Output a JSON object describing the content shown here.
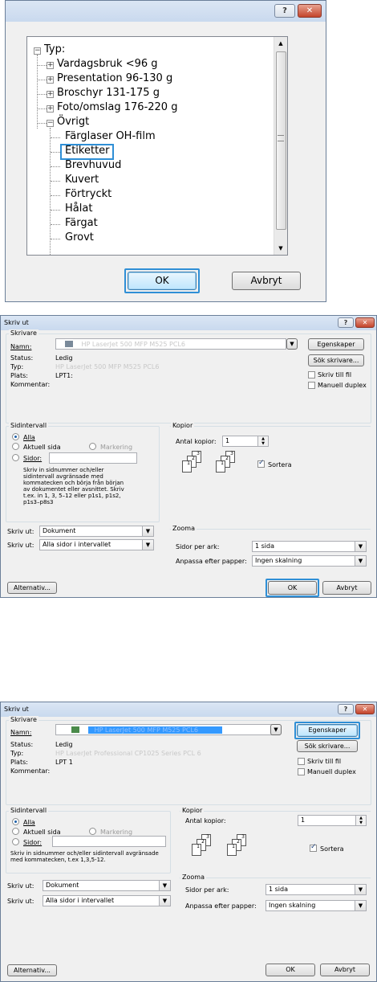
{
  "dialog1": {
    "help_label": "?",
    "close_label": "✕",
    "tree": {
      "root": "Typ:",
      "children": [
        "Vardagsbruk <96 g",
        "Presentation 96-130 g",
        "Broschyr 131-175 g",
        "Foto/omslag 176-220 g"
      ],
      "expanded": "Övrigt",
      "subitems": [
        "Färglaser OH-film",
        "Etiketter",
        "Brevhuvud",
        "Kuvert",
        "Förtryckt",
        "Hålat",
        "Färgat",
        "Grovt"
      ],
      "selected": "Etiketter"
    },
    "ok_label": "OK",
    "cancel_label": "Avbryt"
  },
  "dialog2": {
    "title": "Skriv ut",
    "printer_group": "Skrivare",
    "name_label": "Namn:",
    "printer_name": "HP LaserJet 500 MFP M525 PCL6",
    "properties_label": "Egenskaper",
    "find_printer_label": "Sök skrivare...",
    "status_label": "Status:",
    "status_value": "Ledig",
    "type_label": "Typ:",
    "type_value": "HP LaserJet 500 MFP M525 PCL6",
    "location_label": "Plats:",
    "location_value": "LPT1:",
    "comment_label": "Kommentar:",
    "print_to_file": "Skriv till fil",
    "manual_duplex": "Manuell duplex",
    "range_group": "Sidintervall",
    "all": "Alla",
    "current_page": "Aktuell sida",
    "selection": "Markering",
    "pages": "Sidor:",
    "help_text": "Skriv in sidnummer och/eller sidintervall avgränsade med kommatecken och börja från början av dokumentet eller avsnittet. Skriv t.ex. in 1, 3, 5–12 eller p1s1, p1s2, p1s3–p8s3",
    "print_what_label": "Skriv ut:",
    "print_what_value": "Dokument",
    "print_label": "Skriv ut:",
    "print_value": "Alla sidor i intervallet",
    "copies_group": "Kopior",
    "copies_label": "Antal kopior:",
    "copies_value": "1",
    "collate": "Sortera",
    "zoom_group": "Zooma",
    "pages_per_sheet_label": "Sidor per ark:",
    "pages_per_sheet_value": "1 sida",
    "scale_label": "Anpassa efter papper:",
    "scale_value": "Ingen skalning",
    "options_label": "Alternativ...",
    "ok_label": "OK",
    "cancel_label": "Avbryt"
  },
  "dialog3": {
    "title": "Skriv ut",
    "printer_group": "Skrivare",
    "name_label": "Namn:",
    "printer_name": "HP LaserJet 500 MFP M525 PCL6",
    "properties_label": "Egenskaper",
    "find_printer_label": "Sök skrivare...",
    "status_label": "Status:",
    "status_value": "Ledig",
    "type_label": "Typ:",
    "type_value": "HP LaserJet Professional CP1025 Series PCL 6",
    "location_label": "Plats:",
    "location_value": "LPT 1",
    "comment_label": "Kommentar:",
    "print_to_file": "Skriv till fil",
    "manual_duplex": "Manuell duplex",
    "range_group": "Sidintervall",
    "all": "Alla",
    "current_page": "Aktuell sida",
    "selection": "Markering",
    "pages": "Sidor:",
    "help_text": "Skriv in sidnummer och/eller sidintervall avgränsade med kommatecken, t.ex 1,3,5-12.",
    "print_what_label": "Skriv ut:",
    "print_what_value": "Dokument",
    "print_label": "Skriv ut:",
    "print_value": "Alla sidor i intervallet",
    "copies_group": "Kopior",
    "copies_label": "Antal kopior:",
    "copies_value": "1",
    "collate": "Sortera",
    "zoom_group": "Zooma",
    "pages_per_sheet_label": "Sidor per ark:",
    "pages_per_sheet_value": "1 sida",
    "scale_label": "Anpassa efter papper:",
    "scale_value": "Ingen skalning",
    "options_label": "Alternativ...",
    "ok_label": "OK",
    "cancel_label": "Avbryt"
  }
}
